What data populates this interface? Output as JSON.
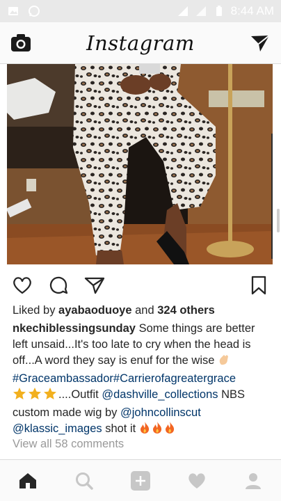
{
  "status_bar": {
    "time": "8:44 AM",
    "icons": [
      "image-icon",
      "whatsapp-icon",
      "signal-icon",
      "data-icon",
      "battery-icon"
    ]
  },
  "header": {
    "title": "Instagram",
    "left_icon": "camera-icon",
    "right_icon": "direct-message-icon"
  },
  "post": {
    "image_description_icon": "photo",
    "actions": {
      "like_icon": "heart-icon",
      "comment_icon": "comment-icon",
      "share_icon": "share-icon",
      "save_icon": "bookmark-icon"
    },
    "likes": {
      "prefix": "Liked by ",
      "user": "ayabaoduoye",
      "middle": " and ",
      "others": "324 others"
    },
    "caption": {
      "username": "nkechiblessingsunday",
      "text": " Some things are better left unsaid...It's too late to cry when the head is off...A word they say is enuf for the wise ",
      "hashtags": "#Graceambassador#Carrierofagreatergrace",
      "after_stars": "....Outfit ",
      "mention1": "@dashville_collections",
      "mid_text": " NBS custom made wig by ",
      "mention2": "@johncollinscut",
      "mention3": "@klassic_images",
      "end_text": " shot it"
    },
    "view_all_comments": "View all 58 comments"
  },
  "bottom_nav": {
    "items": [
      "home-icon",
      "search-icon",
      "add-post-icon",
      "activity-heart-icon",
      "profile-icon"
    ]
  },
  "colors": {
    "link": "#003569",
    "text": "#262626",
    "muted": "#999999",
    "bar_bg": "#fafafa"
  }
}
